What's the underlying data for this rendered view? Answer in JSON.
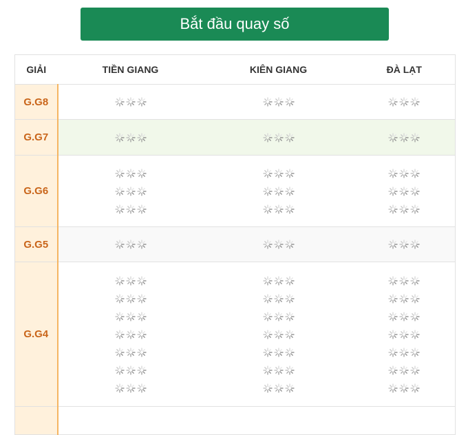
{
  "start_button": {
    "label": "Bắt đầu quay số"
  },
  "table": {
    "headers": [
      "GIẢI",
      "TIỀN GIANG",
      "KIÊN GIANG",
      "ĐÀ LẠT"
    ],
    "prizes": [
      {
        "label": "G.G8",
        "lines": 1
      },
      {
        "label": "G.G7",
        "lines": 1
      },
      {
        "label": "G.G6",
        "lines": 3
      },
      {
        "label": "G.G5",
        "lines": 1
      },
      {
        "label": "G.G4",
        "lines": 7
      }
    ],
    "pending_icon": "loading-spinner-icon"
  },
  "colors": {
    "button_bg": "#1a8a55",
    "prize_text": "#c9651a",
    "prize_bg": "#fff1dc",
    "highlight_row": "#f1f8ea"
  }
}
